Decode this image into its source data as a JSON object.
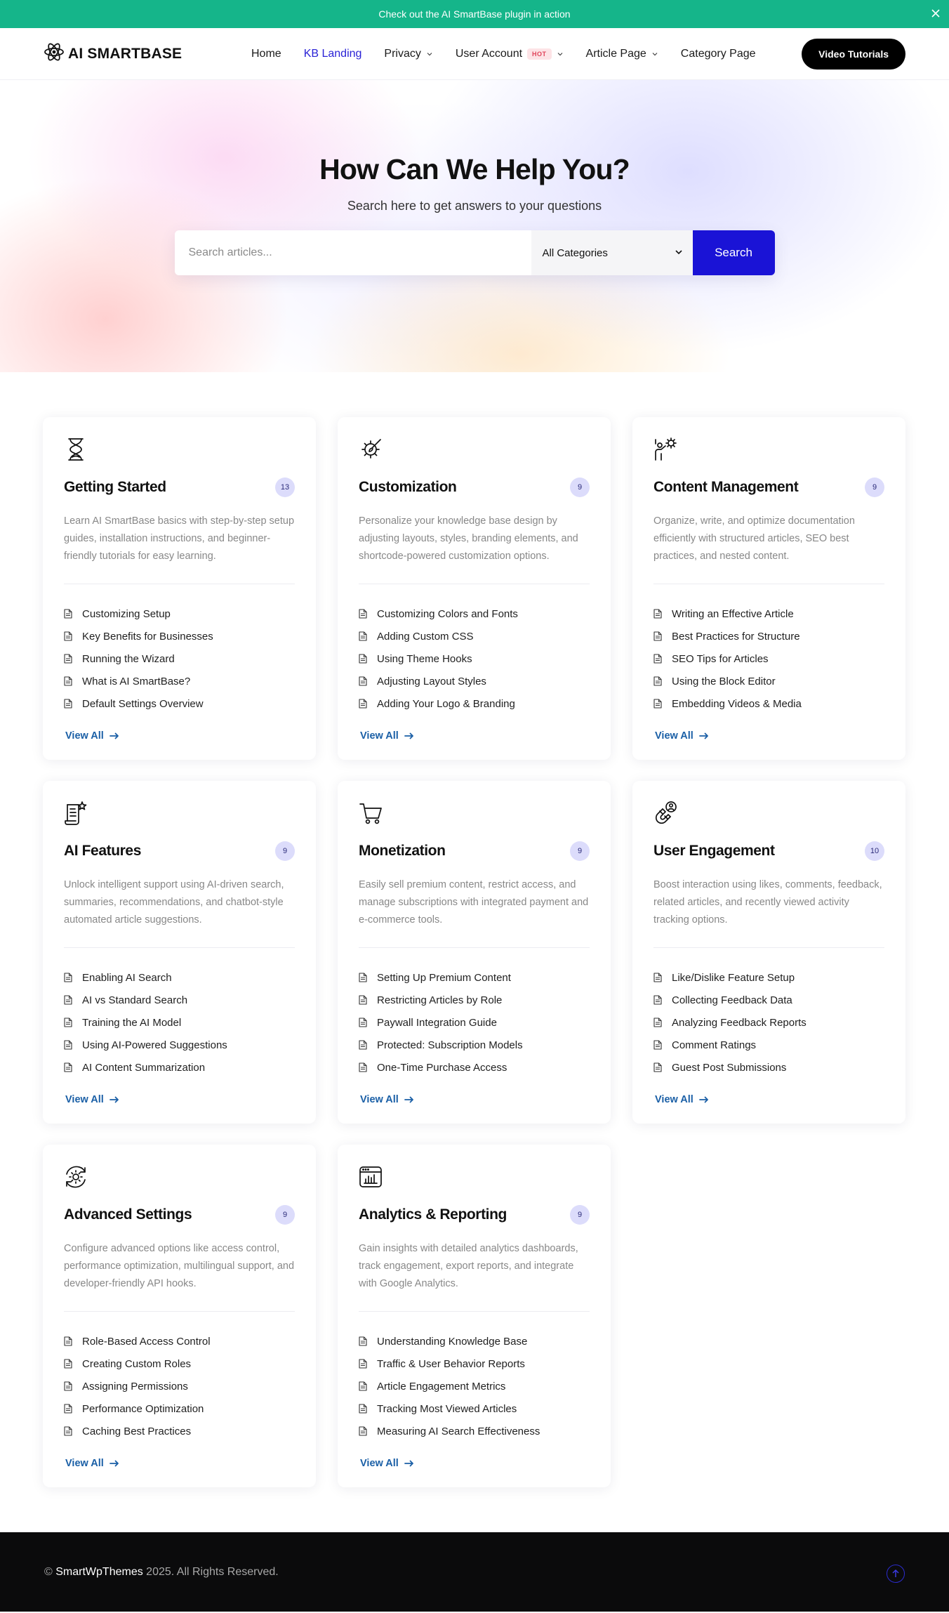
{
  "announcement": {
    "text": "Check out the AI SmartBase plugin in action",
    "close_icon": "close-icon"
  },
  "header": {
    "logo_text": "AI SMARTBASE",
    "nav": [
      {
        "label": "Home",
        "active": false,
        "dropdown": false
      },
      {
        "label": "KB Landing",
        "active": true,
        "dropdown": false
      },
      {
        "label": "Privacy",
        "active": false,
        "dropdown": true
      },
      {
        "label": "User Account",
        "active": false,
        "dropdown": true,
        "badge": "HOT"
      },
      {
        "label": "Article Page",
        "active": false,
        "dropdown": true
      },
      {
        "label": "Category Page",
        "active": false,
        "dropdown": false
      }
    ],
    "cta_label": "Video Tutorials"
  },
  "hero": {
    "title": "How Can We Help You?",
    "subtitle": "Search here to get answers to your questions",
    "search_placeholder": "Search articles...",
    "category_selected": "All Categories",
    "search_button": "Search"
  },
  "colors": {
    "accent": "#1a13d6",
    "announce": "#15b58a",
    "link": "#1a5fa6",
    "count_bg": "#dcdcfb"
  },
  "categories": [
    {
      "icon": "hourglass-icon",
      "title": "Getting Started",
      "count": "13",
      "description": "Learn AI SmartBase basics with step-by-step setup guides, installation instructions, and beginner-friendly tutorials for easy learning.",
      "articles": [
        "Customizing Setup",
        "Key Benefits for Businesses",
        "Running the Wizard",
        "What is AI SmartBase?",
        "Default Settings Overview"
      ],
      "view_all": "View All"
    },
    {
      "icon": "paint-brush-gear-icon",
      "title": "Customization",
      "count": "9",
      "description": "Personalize your knowledge base design by adjusting layouts, styles, branding elements, and shortcode-powered customization options.",
      "articles": [
        "Customizing Colors and Fonts",
        "Adding Custom CSS",
        "Using Theme Hooks",
        "Adjusting Layout Styles",
        "Adding Your Logo & Branding"
      ],
      "view_all": "View All"
    },
    {
      "icon": "person-gear-icon",
      "title": "Content Management",
      "count": "9",
      "description": "Organize, write, and optimize documentation efficiently with structured articles, SEO best practices, and nested content.",
      "articles": [
        "Writing an Effective Article",
        "Best Practices for Structure",
        "SEO Tips for Articles",
        "Using the Block Editor",
        "Embedding Videos & Media"
      ],
      "view_all": "View All"
    },
    {
      "icon": "document-star-icon",
      "title": "AI Features",
      "count": "9",
      "description": "Unlock intelligent support using AI-driven search, summaries, recommendations, and chatbot-style automated article suggestions.",
      "articles": [
        "Enabling AI Search",
        "AI vs Standard Search",
        "Training the AI Model",
        "Using AI-Powered Suggestions",
        "AI Content Summarization"
      ],
      "view_all": "View All"
    },
    {
      "icon": "shopping-cart-icon",
      "title": "Monetization",
      "count": "9",
      "description": "Easily sell premium content, restrict access, and manage subscriptions with integrated payment and e-commerce tools.",
      "articles": [
        "Setting Up Premium Content",
        "Restricting Articles by Role",
        "Paywall Integration Guide",
        "Protected: Subscription Models",
        "One-Time Purchase Access"
      ],
      "view_all": "View All"
    },
    {
      "icon": "magnet-user-icon",
      "title": "User Engagement",
      "count": "10",
      "description": "Boost interaction using likes, comments, feedback, related articles, and recently viewed activity tracking options.",
      "articles": [
        "Like/Dislike Feature Setup",
        "Collecting Feedback Data",
        "Analyzing Feedback Reports",
        "Comment Ratings",
        "Guest Post Submissions"
      ],
      "view_all": "View All"
    },
    {
      "icon": "gear-refresh-icon",
      "title": "Advanced Settings",
      "count": "9",
      "description": "Configure advanced options like access control, performance optimization, multilingual support, and developer-friendly API hooks.",
      "articles": [
        "Role-Based Access Control",
        "Creating Custom Roles",
        "Assigning Permissions",
        "Performance Optimization",
        "Caching Best Practices"
      ],
      "view_all": "View All"
    },
    {
      "icon": "browser-chart-icon",
      "title": "Analytics & Reporting",
      "count": "9",
      "description": "Gain insights with detailed analytics dashboards, track engagement, export reports, and integrate with Google Analytics.",
      "articles": [
        "Understanding Knowledge Base",
        "Traffic & User Behavior Reports",
        "Article Engagement Metrics",
        "Tracking Most Viewed Articles",
        "Measuring AI Search Effectiveness"
      ],
      "view_all": "View All"
    }
  ],
  "footer": {
    "copyright_symbol": "©",
    "brand": "SmartWpThemes",
    "rights": "2025. All Rights Reserved.",
    "to_top_icon": "arrow-up-circle-icon"
  }
}
